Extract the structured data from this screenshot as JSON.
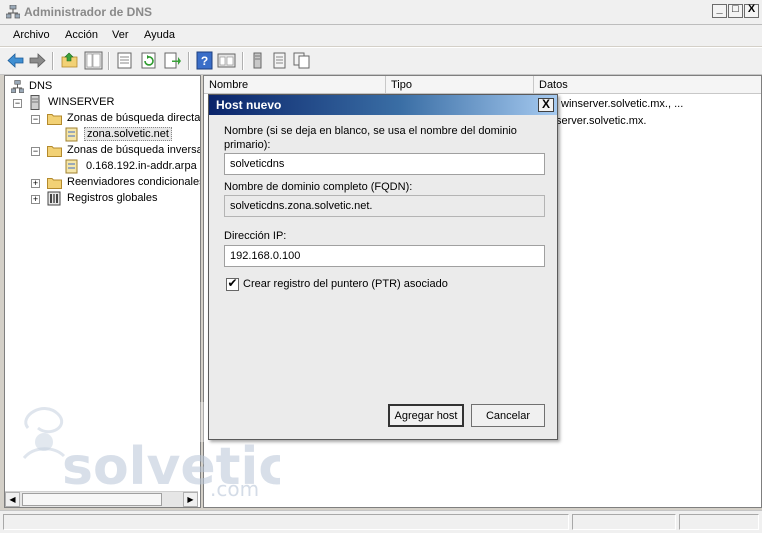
{
  "window": {
    "title": "Administrador de DNS",
    "controls": {
      "minimize": "_",
      "maximize": "□",
      "close": "X"
    }
  },
  "menu": [
    "Archivo",
    "Acción",
    "Ver",
    "Ayuda"
  ],
  "toolbar": {
    "icons": [
      "back-arrow-icon",
      "forward-arrow-icon",
      "up-folder-icon",
      "show-tree-icon",
      "properties-icon",
      "refresh-icon",
      "export-icon",
      "help-icon",
      "view-icon",
      "server-icon",
      "record-icon",
      "copy-icon"
    ]
  },
  "tree": {
    "root": "DNS",
    "server": "WINSERVER",
    "forward_zones": "Zonas de búsqueda directa",
    "forward_zone_item": "zona.solvetic.net",
    "reverse_zones": "Zonas de búsqueda inversa",
    "reverse_zone_item": "0.168.192.in-addr.arpa",
    "conditional_forwarders": "Reenviadores condicionales",
    "global_logs": "Registros globales"
  },
  "list": {
    "columns": [
      "Nombre",
      "Tipo",
      "Datos"
    ],
    "rows": [
      {
        "data": "winserver.solvetic.mx., ..."
      },
      {
        "data": "server.solvetic.mx."
      }
    ]
  },
  "dialog": {
    "title": "Host nuevo",
    "close": "X",
    "name_label": "Nombre (si se deja en blanco, se usa el nombre del dominio primario):",
    "name_value": "solveticdns",
    "fqdn_label": "Nombre de dominio completo (FQDN):",
    "fqdn_value": "solveticdns.zona.solvetic.net.",
    "ip_label": "Dirección IP:",
    "ip_value": "192.168.0.100",
    "ptr_checkbox_label": "Crear registro del puntero (PTR) asociado",
    "ptr_checked": true,
    "add_button": "Agregar host",
    "cancel_button": "Cancelar"
  },
  "watermark": {
    "brand": "solvetic",
    "suffix": ".com"
  }
}
